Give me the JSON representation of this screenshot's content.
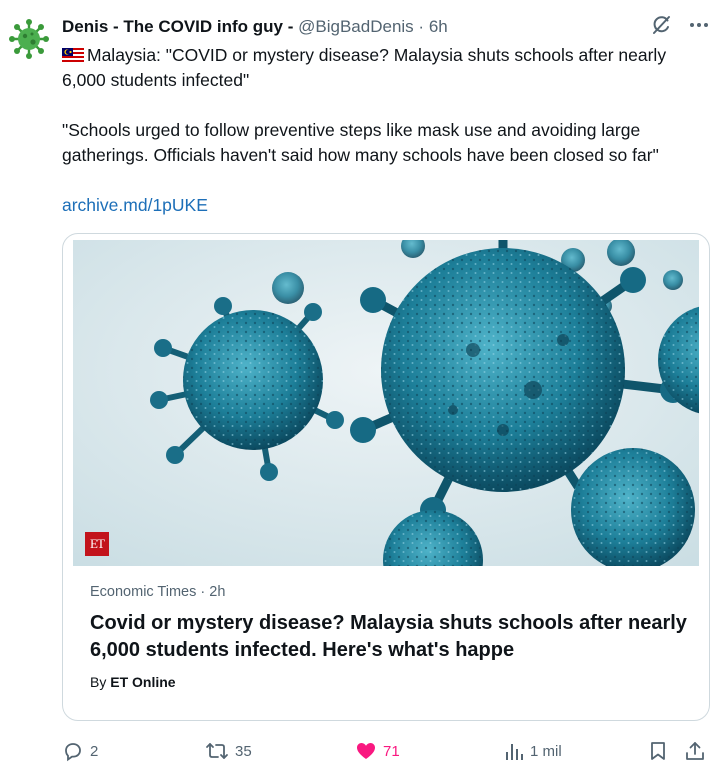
{
  "author": {
    "name": "Denis - The COVID info guy -",
    "handle": "@BigBadDenis",
    "separator": "·",
    "time": "6h",
    "avatar_icon": "virus-avatar-icon"
  },
  "tweet": {
    "flag_icon": "malaysia-flag-icon",
    "paragraph1": "Malaysia: \"COVID or mystery disease? Malaysia shuts schools after nearly 6,000 students infected\"",
    "paragraph2": "\"Schools urged to follow preventive steps like mask use and avoiding large gatherings. Officials haven't said how many schools have been closed so far\"",
    "link": "archive.md/1pUKE"
  },
  "card": {
    "badge": "ET",
    "source": "Economic Times",
    "separator": "·",
    "age": "2h",
    "title": "Covid or mystery disease? Malaysia shuts schools after nearly 6,000 students infected. Here's what's happe",
    "byline_prefix": "By",
    "byline_author": "ET Online"
  },
  "actions": {
    "replies": "2",
    "retweets": "35",
    "likes": "71",
    "views": "1 mil"
  },
  "colors": {
    "accent_link": "#1d6fb8",
    "like": "#f91880",
    "muted": "#536471",
    "border": "#cfd9de"
  }
}
